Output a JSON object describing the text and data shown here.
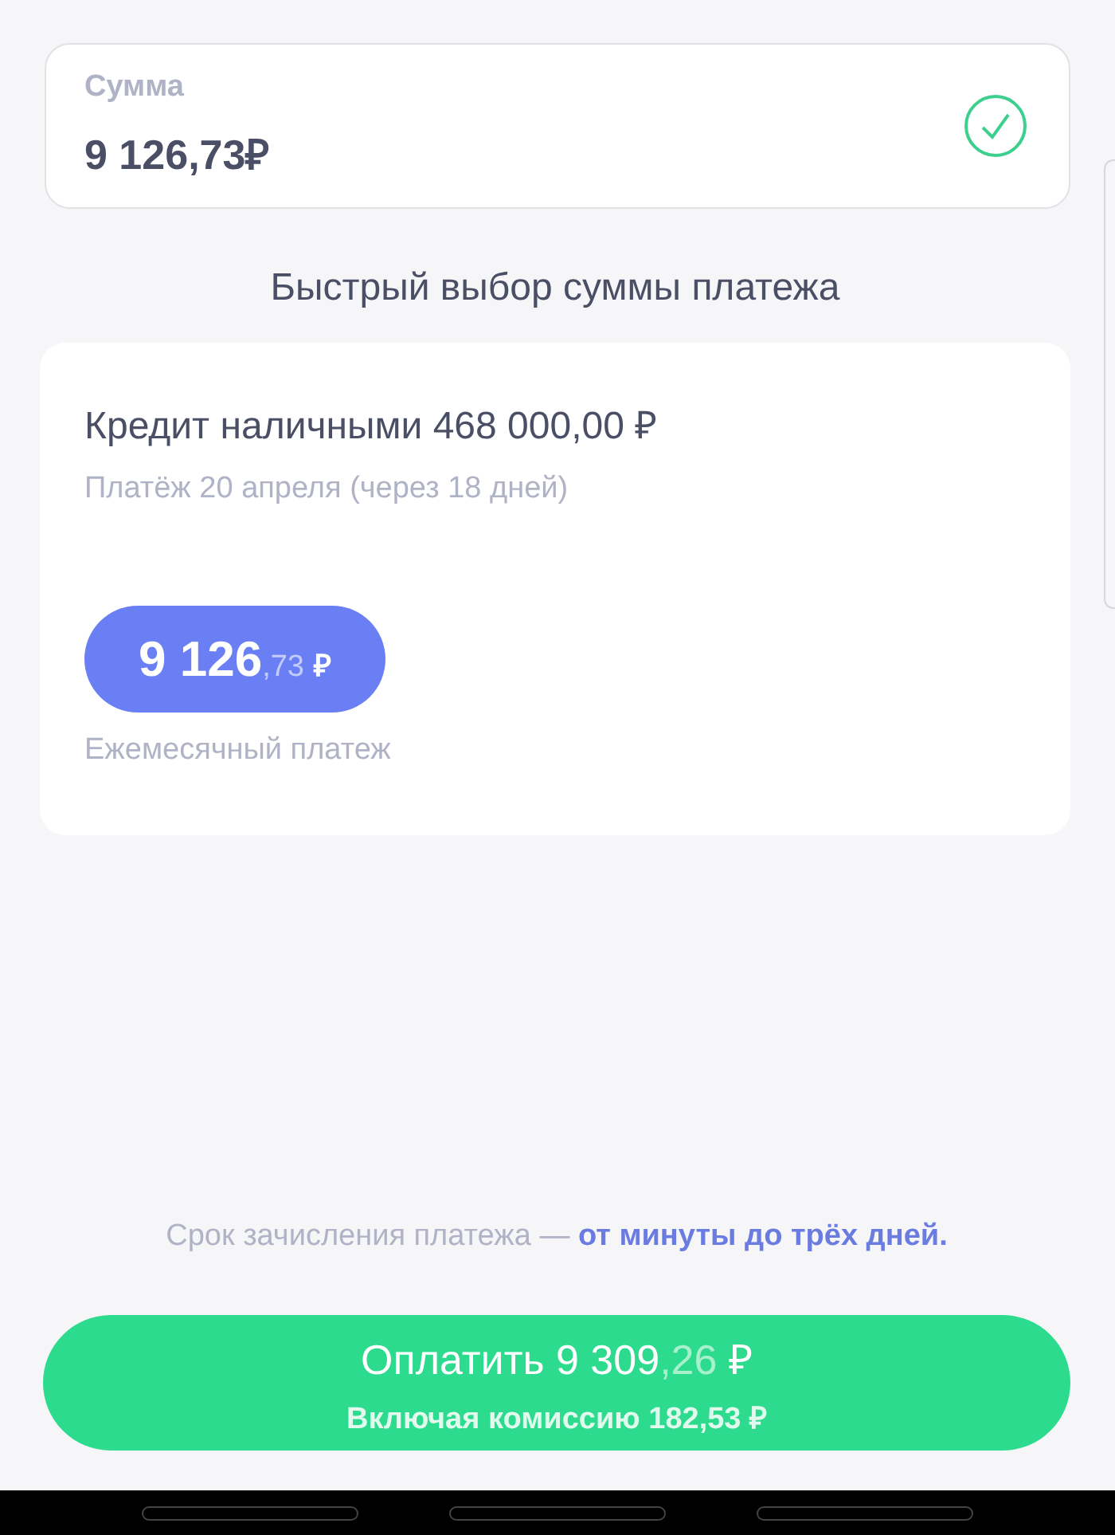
{
  "amount_field": {
    "label": "Сумма",
    "value": "9 126,73₽",
    "valid": true
  },
  "quick_pick": {
    "title": "Быстрый выбор суммы платежа"
  },
  "loan": {
    "title": "Кредит наличными 468 000,00 ₽",
    "due": "Платёж 20 апреля (через 18 дней)",
    "options": [
      {
        "whole": "9 126",
        "fraction": ",73",
        "currency": "₽",
        "caption": "Ежемесячный платеж",
        "selected": true
      }
    ]
  },
  "note": {
    "text": "Срок зачисления платежа —",
    "link": "от минуты до трёх дней."
  },
  "pay_button": {
    "whole": "Оплатить 9 309",
    "fraction": ",26",
    "currency": "₽",
    "fee": "Включая комиссию 182,53 ₽"
  }
}
